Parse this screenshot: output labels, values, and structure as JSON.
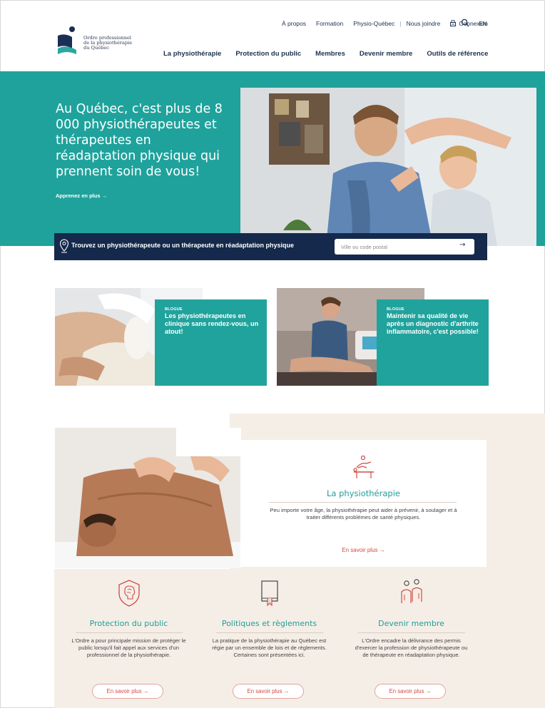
{
  "logo": {
    "org_name_lines": [
      "Ordre professionnel",
      "de la physiothérapie",
      "du Québec"
    ]
  },
  "top_nav": {
    "links": [
      "À propos",
      "Formation",
      "Physio-Québec",
      "Nous joindre"
    ],
    "separator": "|",
    "login": "Connexion",
    "lang": "EN"
  },
  "main_nav": [
    "La physiothérapie",
    "Protection du public",
    "Membres",
    "Devenir membre",
    "Outils de référence"
  ],
  "hero": {
    "title": "Au Québec, c'est plus de 8 000 physiothérapeutes et thérapeutes en réadaptation physique qui prennent soin de vous!",
    "link": "Apprenez en plus →"
  },
  "finder": {
    "label": "Trouvez un physiothérapeute ou un thérapeute en réadaptation physique",
    "placeholder": "Ville ou code postal",
    "go": "→"
  },
  "blog_cards": [
    {
      "kicker": "BLOGUE",
      "title": "Les physiothérapeutes en clinique sans rendez-vous, un atout!"
    },
    {
      "kicker": "BLOGUE",
      "title": "Maintenir sa qualité de vie après un diagnostic d'arthrite inflammatoire, c'est possible!"
    }
  ],
  "physio_feature": {
    "title": "La physiothérapie",
    "description": "Peu importe votre âge, la physiothérapie peut aider à prévenir, à soulager et à traiter différents problèmes de santé physiques.",
    "link": "En savoir plus →"
  },
  "columns": [
    {
      "icon": "shield-brain-icon",
      "title": "Protection du public",
      "description": "L'Ordre a pour principale mission de protéger le public lorsqu'il fait appel aux services d'un professionnel de la physiothérapie.",
      "button": "En savoir plus →"
    },
    {
      "icon": "book-icon",
      "title": "Politiques et règlements",
      "description": "La pratique de la physiothérapie au Québec est régie par un ensemble de lois et de règlements. Certaines sont présentées ici.",
      "button": "En savoir plus →"
    },
    {
      "icon": "people-icon",
      "title": "Devenir membre",
      "description": "L'Ordre encadre la délivrance des permis d'exercer la profession de physiothérapeute ou de thérapeute en réadaptation physique.",
      "button": "En savoir plus →"
    }
  ],
  "colors": {
    "teal": "#1fa29c",
    "navy": "#14294b",
    "coral": "#d24a43",
    "beige": "#f5eee7"
  }
}
